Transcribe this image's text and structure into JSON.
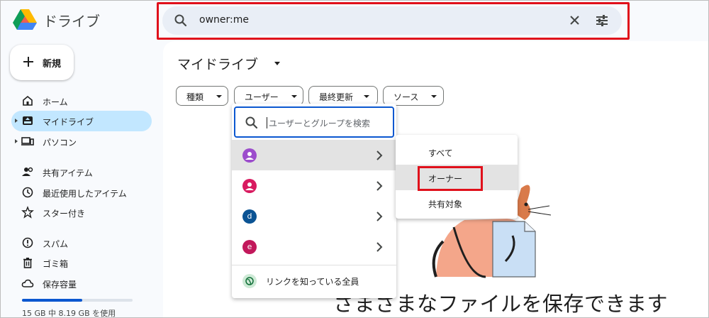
{
  "app": {
    "title": "ドライブ"
  },
  "search": {
    "value": "owner:me",
    "icon": "search-icon",
    "clear_icon": "close-icon",
    "options_icon": "tune-icon"
  },
  "sidebar": {
    "new_label": "新規",
    "items": [
      {
        "label": "ホーム",
        "icon": "home-icon"
      },
      {
        "label": "マイドライブ",
        "icon": "my-drive-icon",
        "active": true
      },
      {
        "label": "パソコン",
        "icon": "computer-icon"
      },
      {
        "label": "共有アイテム",
        "icon": "shared-icon"
      },
      {
        "label": "最近使用したアイテム",
        "icon": "clock-icon"
      },
      {
        "label": "スター付き",
        "icon": "star-icon"
      },
      {
        "label": "スパム",
        "icon": "spam-icon"
      },
      {
        "label": "ゴミ箱",
        "icon": "trash-icon"
      },
      {
        "label": "保存容量",
        "icon": "cloud-icon"
      }
    ],
    "storage": {
      "text": "15 GB 中 8.19 GB を使用",
      "used_fraction": 0.546
    }
  },
  "main": {
    "title": "マイドライブ",
    "filters": [
      {
        "label": "種類"
      },
      {
        "label": "ユーザー"
      },
      {
        "label": "最終更新"
      },
      {
        "label": "ソース"
      }
    ],
    "empty_text": "さまざまなファイルを保存できます"
  },
  "user_menu": {
    "search_placeholder": "ユーザーとグループを検索",
    "users": [
      {
        "initial": "",
        "color": "#9c4dcc"
      },
      {
        "initial": "",
        "color": "#d81b60"
      },
      {
        "initial": "d",
        "color": "#0b5394"
      },
      {
        "initial": "e",
        "color": "#c2185b"
      }
    ],
    "link_label": "リンクを知っている全員"
  },
  "sub_menu": {
    "items": [
      {
        "label": "すべて"
      },
      {
        "label": "オーナー",
        "selected": true
      },
      {
        "label": "共有対象"
      }
    ]
  },
  "colors": {
    "highlight": "#e0101b",
    "accent": "#0b57d0",
    "active_nav": "#c2e7ff"
  }
}
